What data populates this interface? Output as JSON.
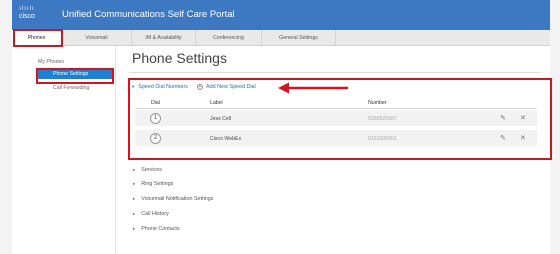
{
  "header": {
    "brand_dots": "ılıılı",
    "brand_text": "cisco",
    "title": "Unified Communications Self Care Portal"
  },
  "tabs": [
    {
      "label": "Phones"
    },
    {
      "label": "Voicemail"
    },
    {
      "label": "IM & Availability"
    },
    {
      "label": "Conferencing"
    },
    {
      "label": "General Settings"
    }
  ],
  "sidebar": {
    "items": [
      {
        "label": "My Phones"
      },
      {
        "label": "Phone Settings"
      },
      {
        "label": "Call Forwarding"
      }
    ]
  },
  "main": {
    "title": "Phone Settings",
    "speed_dial": {
      "heading": "Speed Dial Numbers",
      "add_label": "Add New Speed Dial",
      "columns": [
        "Dial",
        "Label",
        "Number"
      ],
      "rows": [
        {
          "dial": "1",
          "label": "Jess Cell",
          "number": "9186520987"
        },
        {
          "dial": "2",
          "label": "Cisco WebEx",
          "number": "9161000001"
        }
      ],
      "edit_glyph": "✎",
      "delete_glyph": "✕"
    },
    "sections": [
      {
        "label": "Services"
      },
      {
        "label": "Ring Settings"
      },
      {
        "label": "Voicemail Notification Settings"
      },
      {
        "label": "Call History"
      },
      {
        "label": "Phone Contacts"
      }
    ]
  },
  "annotation_color": "#d3131e",
  "icons": {
    "expanded_caret": "▾",
    "collapsed_caret": "▸",
    "add_icon": "+"
  }
}
